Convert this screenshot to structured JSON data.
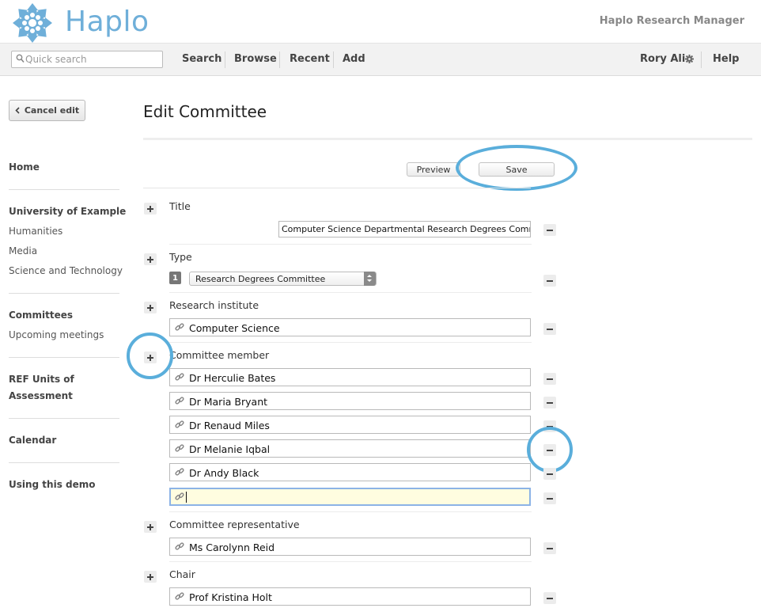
{
  "header": {
    "brand": "Haplo",
    "app_name": "Haplo Research Manager"
  },
  "nav": {
    "search_placeholder": "Quick search",
    "items": [
      "Search",
      "Browse",
      "Recent",
      "Add"
    ],
    "user": "Rory Ali",
    "help": "Help"
  },
  "sidebar": {
    "cancel": "Cancel edit",
    "sections": [
      {
        "heading": "Home",
        "links": []
      },
      {
        "heading": "University of Example",
        "links": [
          "Humanities",
          "Media",
          "Science and Technology"
        ]
      },
      {
        "heading": "Committees",
        "links": [
          "Upcoming meetings"
        ]
      },
      {
        "heading": "REF Units of Assessment",
        "links": []
      },
      {
        "heading": "Calendar",
        "links": []
      },
      {
        "heading": "Using this demo",
        "links": []
      }
    ]
  },
  "main": {
    "title": "Edit Committee",
    "preview": "Preview",
    "save": "Save",
    "fields": {
      "title_label": "Title",
      "title_value": "Computer Science Departmental Research Degrees Committee",
      "type_label": "Type",
      "type_index": "1",
      "type_value": "Research Degrees Committee",
      "institute_label": "Research institute",
      "institute_value": "Computer Science",
      "member_label": "Committee member",
      "members": [
        "Dr Herculie Bates",
        "Dr Maria Bryant",
        "Dr Renaud Miles",
        "Dr Melanie Iqbal",
        "Dr Andy Black",
        ""
      ],
      "rep_label": "Committee representative",
      "rep_value": "Ms Carolynn Reid",
      "chair_label": "Chair",
      "chair_value": "Prof Kristina Holt"
    }
  },
  "colors": {
    "brand": "#6fafd9",
    "highlight": "#5aaedb",
    "active_field_bg": "#fffde0",
    "active_field_border": "#8cb3e6"
  }
}
